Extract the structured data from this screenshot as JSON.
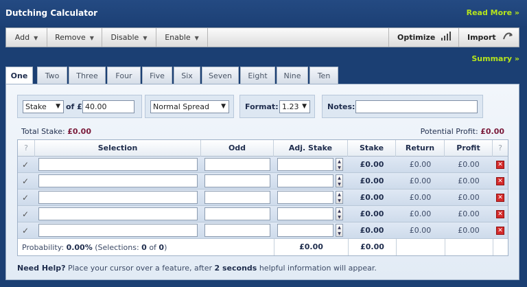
{
  "app": {
    "title": "Dutching Calculator",
    "read_more": "Read More »",
    "summary": "Summary »"
  },
  "toolbar": {
    "add": "Add",
    "remove": "Remove",
    "disable": "Disable",
    "enable": "Enable",
    "optimize": "Optimize",
    "import": "Import"
  },
  "tabs": [
    "One",
    "Two",
    "Three",
    "Four",
    "Five",
    "Six",
    "Seven",
    "Eight",
    "Nine",
    "Ten"
  ],
  "controls": {
    "mode_value": "Stake",
    "of_label": "of £",
    "amount_value": "40.00",
    "spread_value": "Normal Spread",
    "format_label": "Format:",
    "format_value": "1.23",
    "notes_label": "Notes:",
    "notes_value": ""
  },
  "totals": {
    "total_stake_label": "Total Stake:",
    "total_stake": "£0.00",
    "potential_profit_label": "Potential Profit:",
    "potential_profit": "£0.00"
  },
  "columns": {
    "q1": "?",
    "selection": "Selection",
    "odd": "Odd",
    "adj_stake": "Adj. Stake",
    "stake": "Stake",
    "return": "Return",
    "profit": "Profit",
    "q2": "?"
  },
  "rows": [
    {
      "stake": "£0.00",
      "return": "£0.00",
      "profit": "£0.00"
    },
    {
      "stake": "£0.00",
      "return": "£0.00",
      "profit": "£0.00"
    },
    {
      "stake": "£0.00",
      "return": "£0.00",
      "profit": "£0.00"
    },
    {
      "stake": "£0.00",
      "return": "£0.00",
      "profit": "£0.00"
    },
    {
      "stake": "£0.00",
      "return": "£0.00",
      "profit": "£0.00"
    }
  ],
  "footer": {
    "probability_label": "Probability:",
    "probability": "0.00%",
    "selections_label": "(Selections:",
    "selections_count": "0",
    "of_word": "of",
    "selections_total": "0",
    "close_paren": ")",
    "adj_total": "£0.00",
    "stake_total": "£0.00"
  },
  "help": {
    "lead": "Need Help?",
    "text1": " Place your cursor over a feature, after ",
    "seconds": "2 seconds",
    "text2": " helpful information will appear."
  },
  "colors": {
    "background": "#1b3f73",
    "accent": "#b6e51c",
    "amount": "#7a1a3a"
  }
}
